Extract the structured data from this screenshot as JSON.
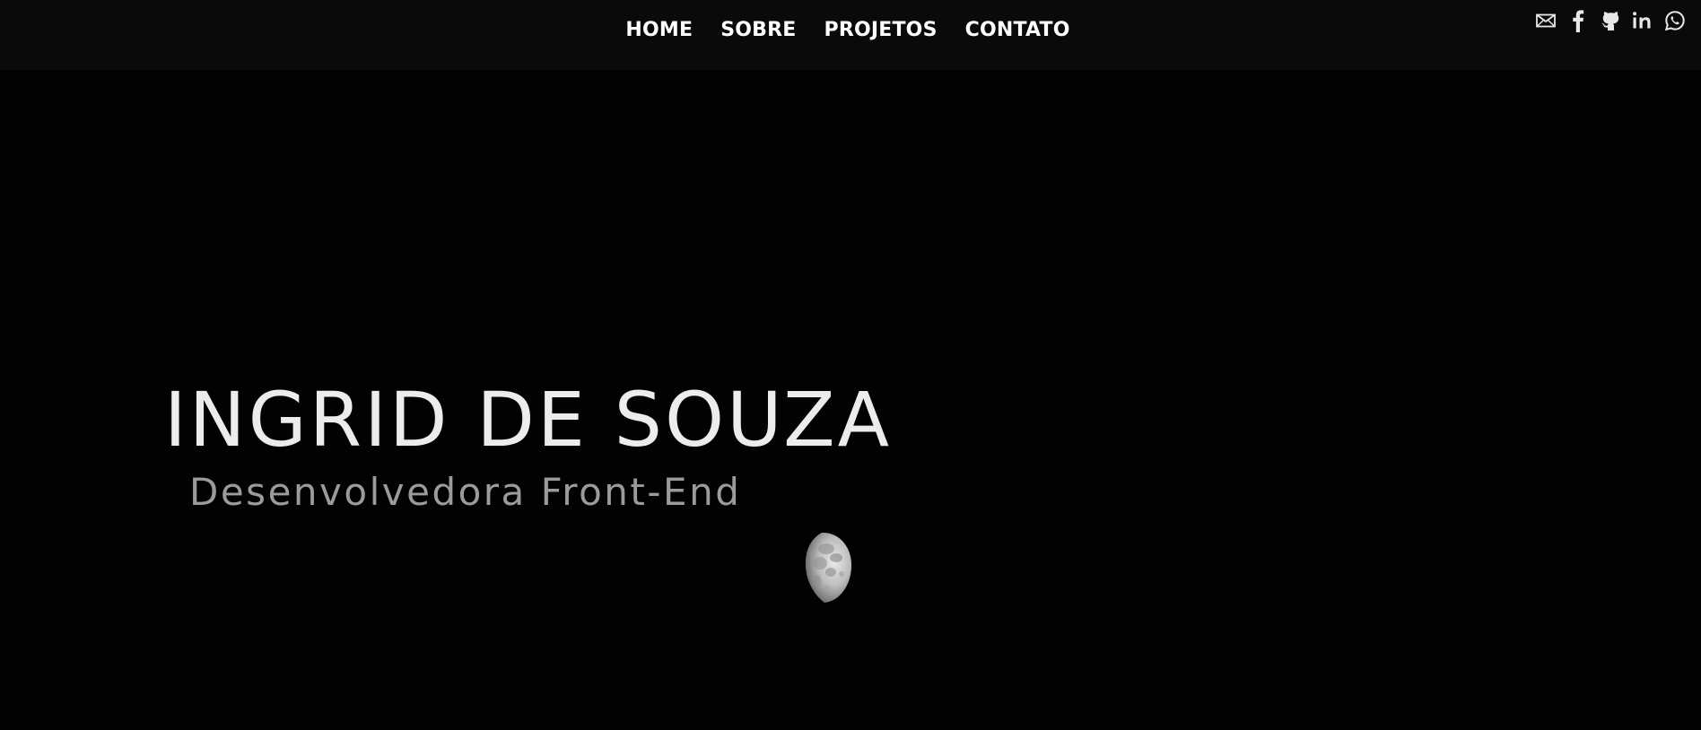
{
  "nav": {
    "items": [
      {
        "label": "HOME"
      },
      {
        "label": "SOBRE"
      },
      {
        "label": "PROJETOS"
      },
      {
        "label": "CONTATO"
      }
    ]
  },
  "social": {
    "icons": [
      "mail-icon",
      "facebook-icon",
      "github-icon",
      "linkedin-icon",
      "whatsapp-icon"
    ]
  },
  "hero": {
    "name": "INGRID DE SOUZA",
    "subtitle": "Desenvolvedora Front-End"
  },
  "colors": {
    "background": "#020202",
    "header": "#0a0a0a",
    "name_text": "#ececec",
    "subtitle_text": "#9b9b9b"
  }
}
